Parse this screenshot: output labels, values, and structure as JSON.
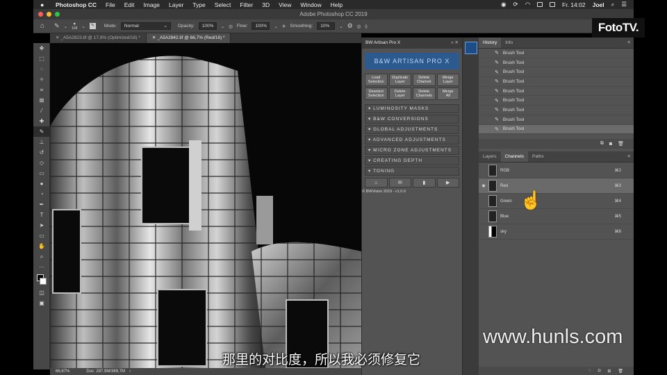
{
  "menubar": {
    "app": "Photoshop CC",
    "items": [
      "File",
      "Edit",
      "Image",
      "Layer",
      "Type",
      "Select",
      "Filter",
      "3D",
      "View",
      "Window",
      "Help"
    ],
    "time": "Fr. 14:02",
    "user": "Joel"
  },
  "window": {
    "title": "Adobe Photoshop CC 2019"
  },
  "options": {
    "brush_size": "168",
    "mode_label": "Mode:",
    "mode_value": "Normal",
    "opacity_label": "Opacity:",
    "opacity_value": "100%",
    "flow_label": "Flow:",
    "flow_value": "100%",
    "smoothing_label": "Smoothing:",
    "smoothing_value": "10%"
  },
  "tabs": [
    {
      "label": "_A5A2823.tif @ 17,9% (Optimized/16) *"
    },
    {
      "label": "_A5A2842.tif @ 66,7% (Red/16) *"
    }
  ],
  "status": {
    "zoom": "66,67%",
    "doc": "Doc: 287,9M/369,7M"
  },
  "bw_panel": {
    "title": "BW Artisan Pro X",
    "logo": "B&W ARTISAN PRO X",
    "buttons": [
      [
        "Load",
        "Selection"
      ],
      [
        "Duplicate",
        "Layer"
      ],
      [
        "Delete",
        "Channel"
      ],
      [
        "Merge",
        "Layer"
      ],
      [
        "Deselect",
        "Selection"
      ],
      [
        "Delete",
        "Layer"
      ],
      [
        "Delete",
        "Channels"
      ],
      [
        "Merge",
        "All"
      ]
    ],
    "sections": [
      "LUMINOSITY MASKS",
      "B&W CONVERSIONS",
      "GLOBAL ADJUSTMENTS",
      "ADVANCED ADJUSTMENTS",
      "MICRO ZONE ADJUSTMENTS",
      "CREATING DEPTH",
      "TONING"
    ],
    "copyright": "© BWVision 2019 - v1.0.0"
  },
  "history": {
    "tabs": [
      "History",
      "Info"
    ],
    "items": [
      "Brush Tool",
      "Brush Tool",
      "Brush Tool",
      "Brush Tool",
      "Brush Tool",
      "Brush Tool",
      "Brush Tool",
      "Brush Tool",
      "Brush Tool"
    ]
  },
  "channels": {
    "tabs": [
      "Layers",
      "Channels",
      "Paths"
    ],
    "items": [
      {
        "name": "RGB",
        "key": "⌘2"
      },
      {
        "name": "Red",
        "key": "⌘3"
      },
      {
        "name": "Green",
        "key": "⌘4"
      },
      {
        "name": "Blue",
        "key": "⌘5"
      },
      {
        "name": "sky",
        "key": "⌘6"
      }
    ]
  },
  "overlay": {
    "brand": "FotoTV.",
    "watermark": "www.hunls.com",
    "subtitle": "那里的对比度，所以我必须修复它"
  },
  "colors": {
    "accent_logo": "#2d5a8e",
    "panel_bg": "#535353"
  }
}
